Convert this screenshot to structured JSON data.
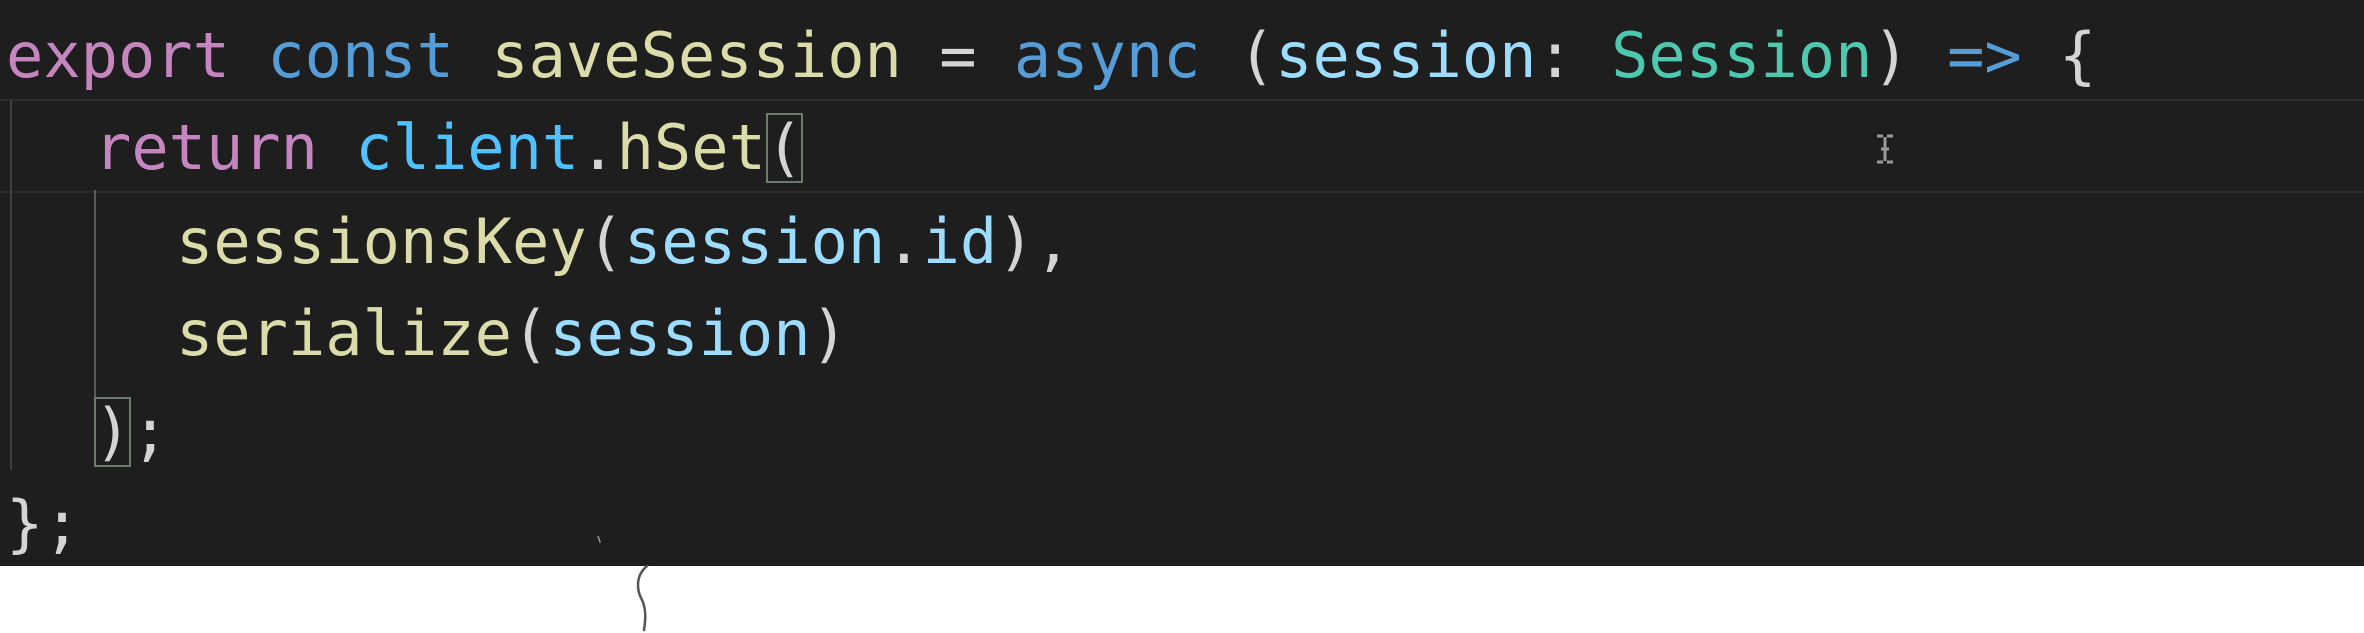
{
  "code": {
    "line1": {
      "export": "export",
      "const": "const",
      "name": "saveSession",
      "eq": "=",
      "async": "async",
      "open_paren": "(",
      "param": "session",
      "colon": ":",
      "type": "Session",
      "close_paren": ")",
      "arrow": "=>",
      "open_brace": "{"
    },
    "line2": {
      "return": "return",
      "obj": "client",
      "dot": ".",
      "method": "hSet",
      "open_paren": "("
    },
    "line3": {
      "fn": "sessionsKey",
      "open_paren": "(",
      "obj": "session",
      "dot": ".",
      "prop": "id",
      "close": "),"
    },
    "line4": {
      "fn": "serialize",
      "open_paren": "(",
      "arg": "session",
      "close_paren": ")"
    },
    "line5": {
      "close_paren": ")",
      "semi": ";"
    },
    "line6": {
      "close": "};"
    }
  },
  "theme": {
    "background": "#1e1e1e",
    "keyword": "#c586c0",
    "declaration": "#569cd6",
    "function": "#dcdcaa",
    "variable": "#9cdcfe",
    "type": "#4ec9b0"
  }
}
